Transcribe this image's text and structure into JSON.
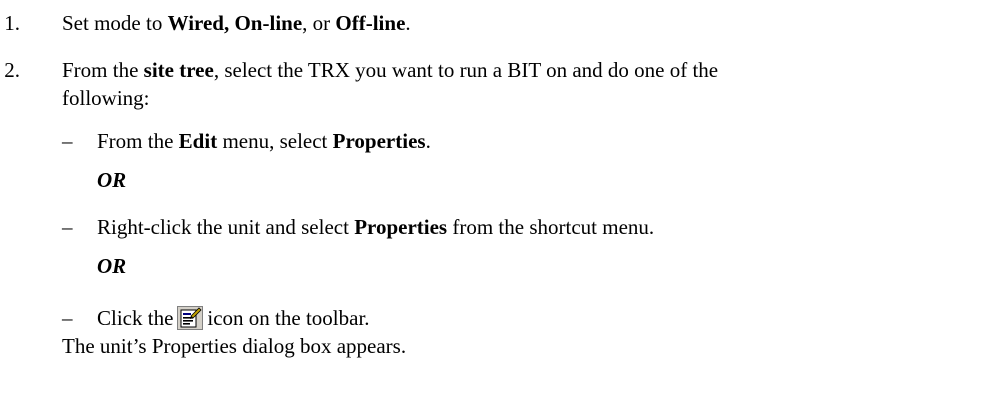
{
  "steps": [
    {
      "number": "1.",
      "text_a": "Set mode to ",
      "bold_a": "Wired, On-line",
      "text_b": ", or ",
      "bold_b": "Off-line",
      "text_c": "."
    },
    {
      "number": "2.",
      "text_a": "From the ",
      "bold_a": "site tree",
      "text_b": ", select the TRX you want to run a BIT on and do one of the",
      "text_c": "following:",
      "options": [
        {
          "dash": "–",
          "text_a": "From the ",
          "bold_a": "Edit",
          "text_b": " menu, select ",
          "bold_b": "Properties",
          "text_c": "."
        },
        {
          "dash": "–",
          "text_a": "Right-click the unit and select ",
          "bold_a": "Properties",
          "text_b": " from the shortcut menu."
        },
        {
          "dash": "–",
          "text_a": "Click the",
          "icon": "properties-toolbar-icon",
          "text_b": "icon on the toolbar."
        }
      ],
      "separator": "OR"
    }
  ],
  "result": "The unit’s Properties dialog box appears."
}
